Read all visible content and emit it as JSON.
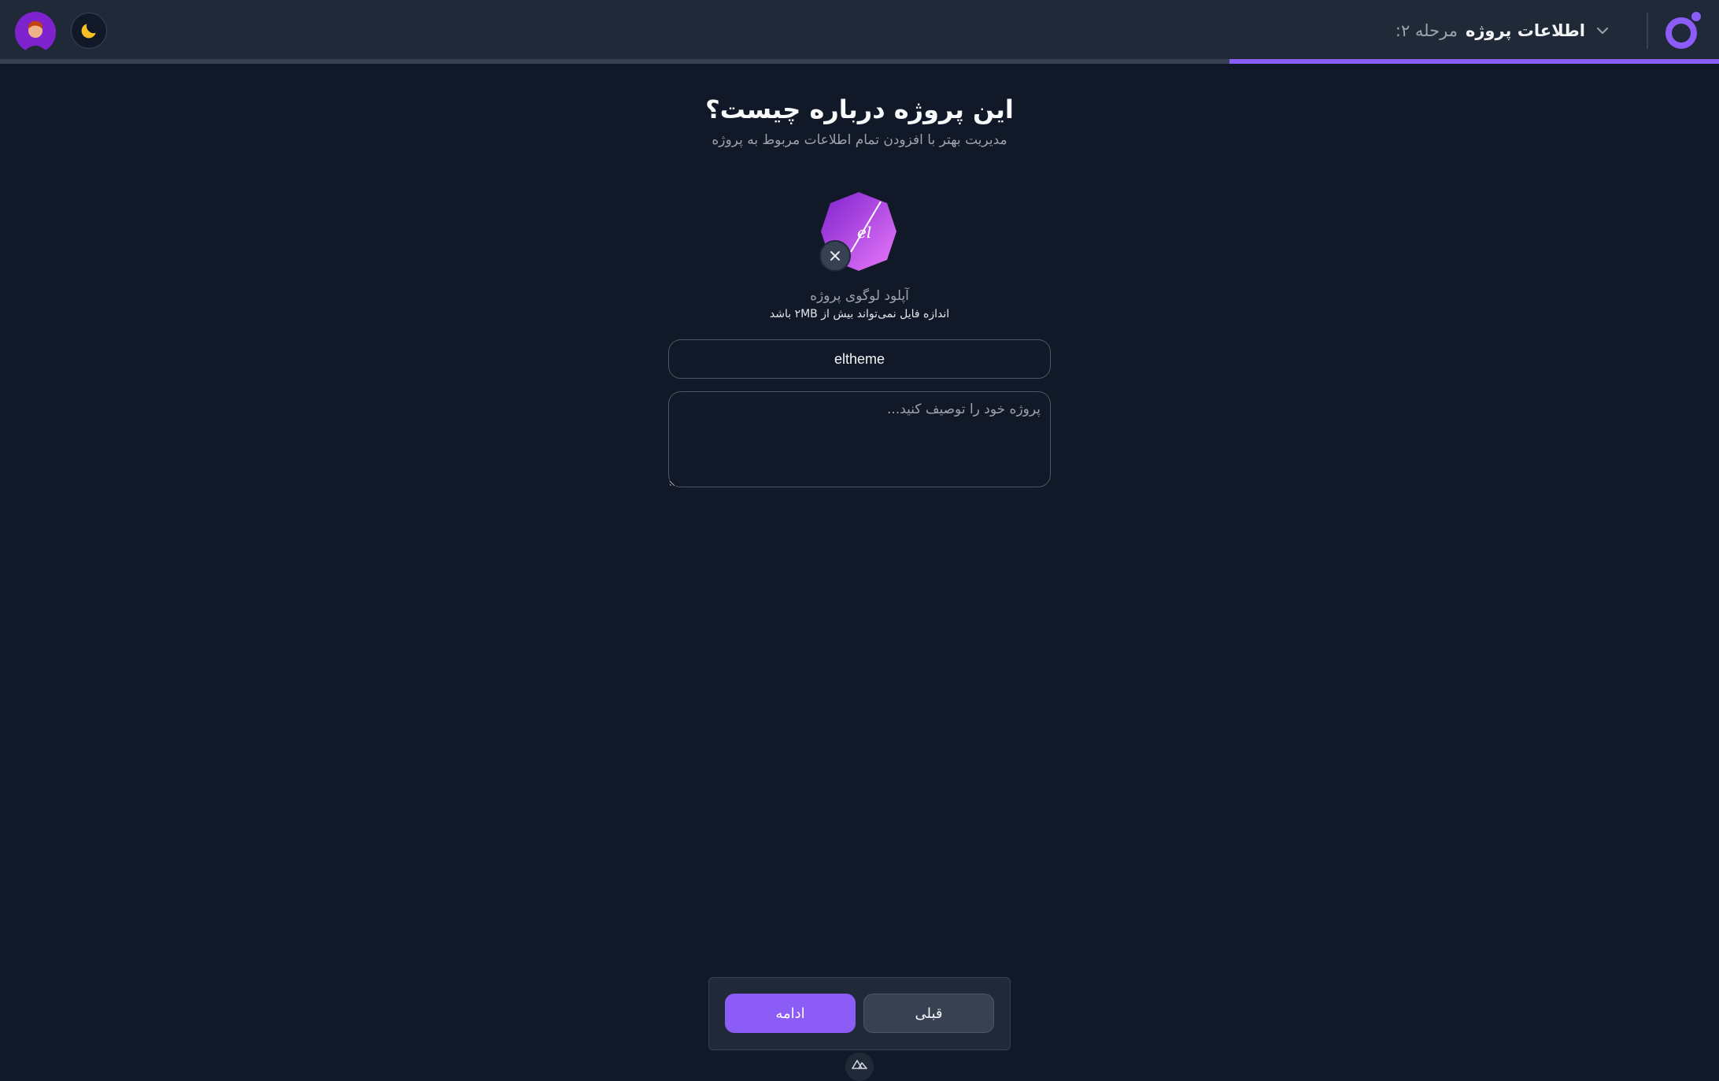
{
  "header": {
    "step_label": "مرحله ۲:",
    "step_title": "اطلاعات پروژه",
    "progress_fraction": 0.285,
    "icons": {
      "brand": "brand-logo-icon",
      "chevron": "chevron-down-icon",
      "theme": "moon-icon",
      "avatar": "user-avatar"
    }
  },
  "main": {
    "title": "این پروژه درباره چیست؟",
    "subtitle": "مدیریت بهتر با افزودن تمام اطلاعات مربوط به پروژه",
    "upload": {
      "label": "آپلود لوگوی پروژه",
      "hint": "اندازه فایل نمی‌تواند بیش از ۲MB باشد"
    },
    "name_input": {
      "value": "eltheme"
    },
    "description": {
      "placeholder": "پروژه خود را توصیف کنید...",
      "value": ""
    }
  },
  "actions": {
    "next_label": "ادامه",
    "prev_label": "قبلی"
  },
  "colors": {
    "accent": "#8b5cf6",
    "background": "#111827",
    "surface": "#1f2937"
  }
}
